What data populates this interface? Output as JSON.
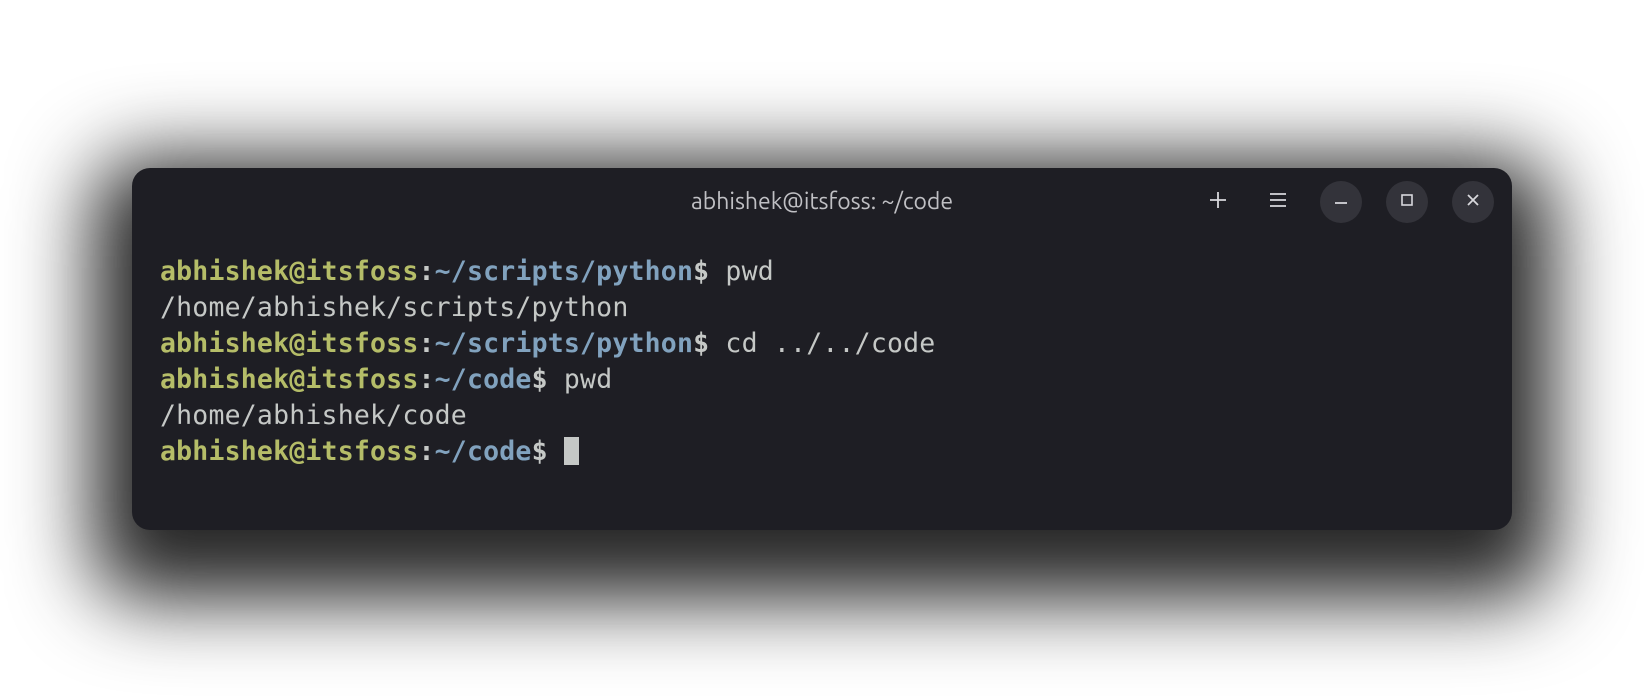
{
  "titlebar": {
    "title": "abhishek@itsfoss: ~/code"
  },
  "lines": [
    {
      "type": "prompt",
      "userhost": "abhishek@itsfoss",
      "colon": ":",
      "path": "~/scripts/python",
      "dollar": "$",
      "command": " pwd"
    },
    {
      "type": "output",
      "text": "/home/abhishek/scripts/python"
    },
    {
      "type": "prompt",
      "userhost": "abhishek@itsfoss",
      "colon": ":",
      "path": "~/scripts/python",
      "dollar": "$",
      "command": " cd ../../code"
    },
    {
      "type": "prompt",
      "userhost": "abhishek@itsfoss",
      "colon": ":",
      "path": "~/code",
      "dollar": "$",
      "command": " pwd"
    },
    {
      "type": "output",
      "text": "/home/abhishek/code"
    },
    {
      "type": "prompt",
      "userhost": "abhishek@itsfoss",
      "colon": ":",
      "path": "~/code",
      "dollar": "$",
      "command": " ",
      "cursor": true
    }
  ]
}
